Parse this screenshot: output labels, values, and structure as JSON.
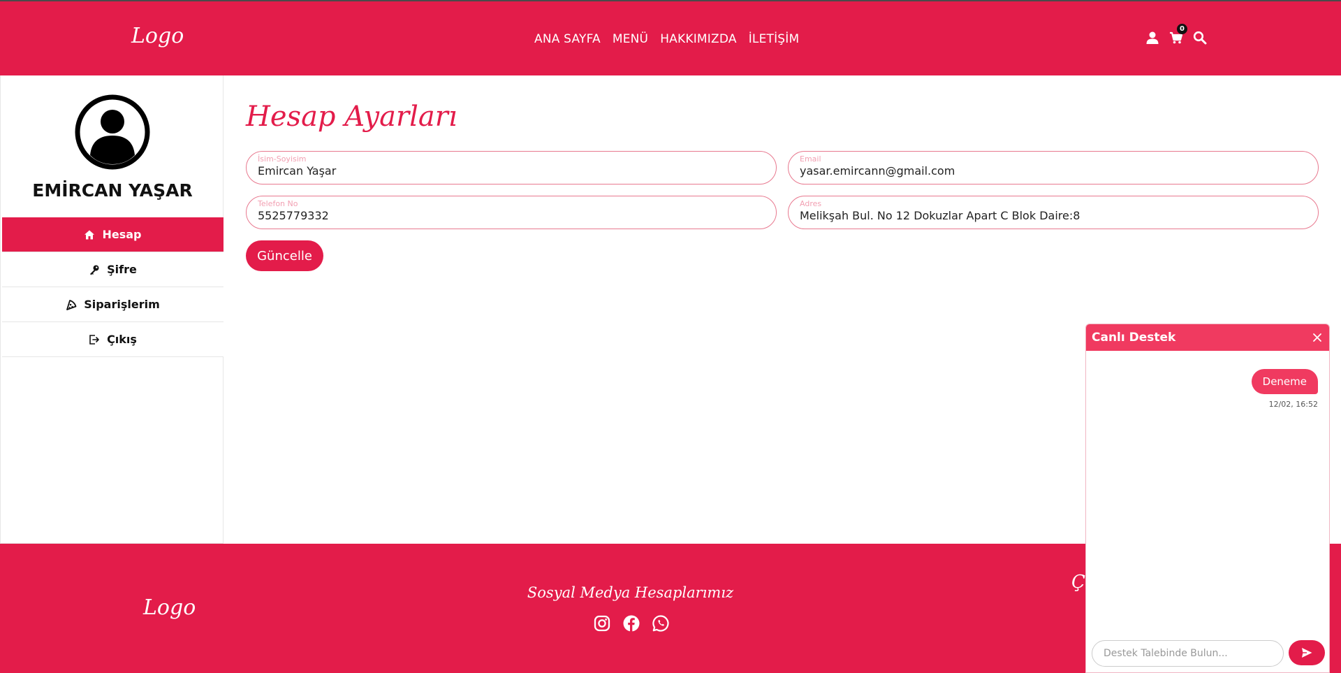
{
  "header": {
    "logo": "Logo",
    "nav": [
      "ANA SAYFA",
      "MENÜ",
      "HAKKIMIZDA",
      "İLETİŞİM"
    ],
    "icons": [
      "user-icon",
      "cart-icon",
      "search-icon"
    ],
    "cart_count": "0"
  },
  "profile": {
    "name": "EMİRCAN YAŞAR"
  },
  "sidebar": {
    "items": [
      {
        "label": "Hesap",
        "icon": "home-icon",
        "active": true
      },
      {
        "label": "Şifre",
        "icon": "key-icon",
        "active": false
      },
      {
        "label": "Siparişlerim",
        "icon": "pizza-icon",
        "active": false
      },
      {
        "label": "Çıkış",
        "icon": "logout-icon",
        "active": false
      }
    ]
  },
  "main": {
    "title": "Hesap Ayarları",
    "fields": {
      "name": {
        "label": "İsim-Soyisim",
        "value": "Emircan Yaşar"
      },
      "email": {
        "label": "Email",
        "value": "yasar.emircann@gmail.com"
      },
      "phone": {
        "label": "Telefon No",
        "value": "5525779332"
      },
      "address": {
        "label": "Adres",
        "value": "Melikşah Bul. No 12 Dokuzlar Apart C Blok Daire:8"
      }
    },
    "update_button": "Güncelle"
  },
  "footer": {
    "logo": "Logo",
    "social_title": "Sosyal Medya Hesaplarımız",
    "social_icons": [
      "instagram-icon",
      "facebook-icon",
      "whatsapp-icon"
    ],
    "partial_text": "Ç"
  },
  "chat": {
    "title": "Canlı Destek",
    "message": "Deneme",
    "time": "12/02, 16:52",
    "input_placeholder": "Destek Talebinde Bulun..."
  },
  "colors": {
    "brand": "#e31c4a",
    "chat_header": "#f03a60"
  }
}
